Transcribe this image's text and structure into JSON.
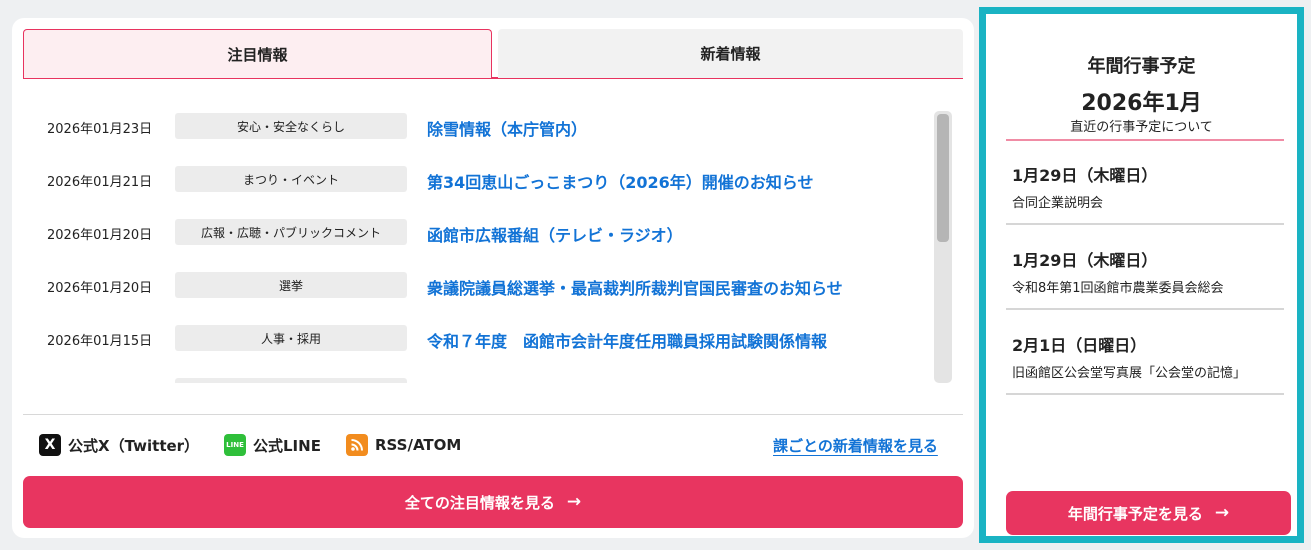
{
  "tabs": {
    "featured": "注目情報",
    "latest": "新着情報"
  },
  "news": [
    {
      "date": "2026年01月23日",
      "category": "安心・安全なくらし",
      "title": "除雪情報（本庁管内）"
    },
    {
      "date": "2026年01月21日",
      "category": "まつり・イベント",
      "title": "第34回恵山ごっこまつり（2026年）開催のお知らせ"
    },
    {
      "date": "2026年01月20日",
      "category": "広報・広聴・パブリックコメント",
      "title": "函館市広報番組（テレビ・ラジオ）"
    },
    {
      "date": "2026年01月20日",
      "category": "選挙",
      "title": "衆議院議員総選挙・最高裁判所裁判官国民審査のお知らせ"
    },
    {
      "date": "2026年01月15日",
      "category": "人事・採用",
      "title": "令和７年度　函館市会計年度任用職員採用試験関係情報"
    }
  ],
  "social": {
    "x_label": "公式X（Twitter）",
    "line_label": "公式LINE",
    "rss_label": "RSS/ATOM",
    "x_icon": "X",
    "line_icon": "LINE",
    "rss_icon": "rss-icon"
  },
  "dept_link": "課ごとの新着情報を見る",
  "all_button": "全ての注目情報を見る",
  "events": {
    "title": "年間行事予定",
    "month": "2026年1月",
    "subtitle": "直近の行事予定について",
    "items": [
      {
        "date": "1月29日（木曜日）",
        "name": "合同企業説明会"
      },
      {
        "date": "1月29日（木曜日）",
        "name": "令和8年第1回函館市農業委員会総会"
      },
      {
        "date": "2月1日（日曜日）",
        "name": "旧函館区公会堂写真展「公会堂の記憶」"
      }
    ],
    "button": "年間行事予定を見る"
  },
  "colors": {
    "accent": "#e83560",
    "link": "#1273d6",
    "frame": "#1ab3c3"
  }
}
